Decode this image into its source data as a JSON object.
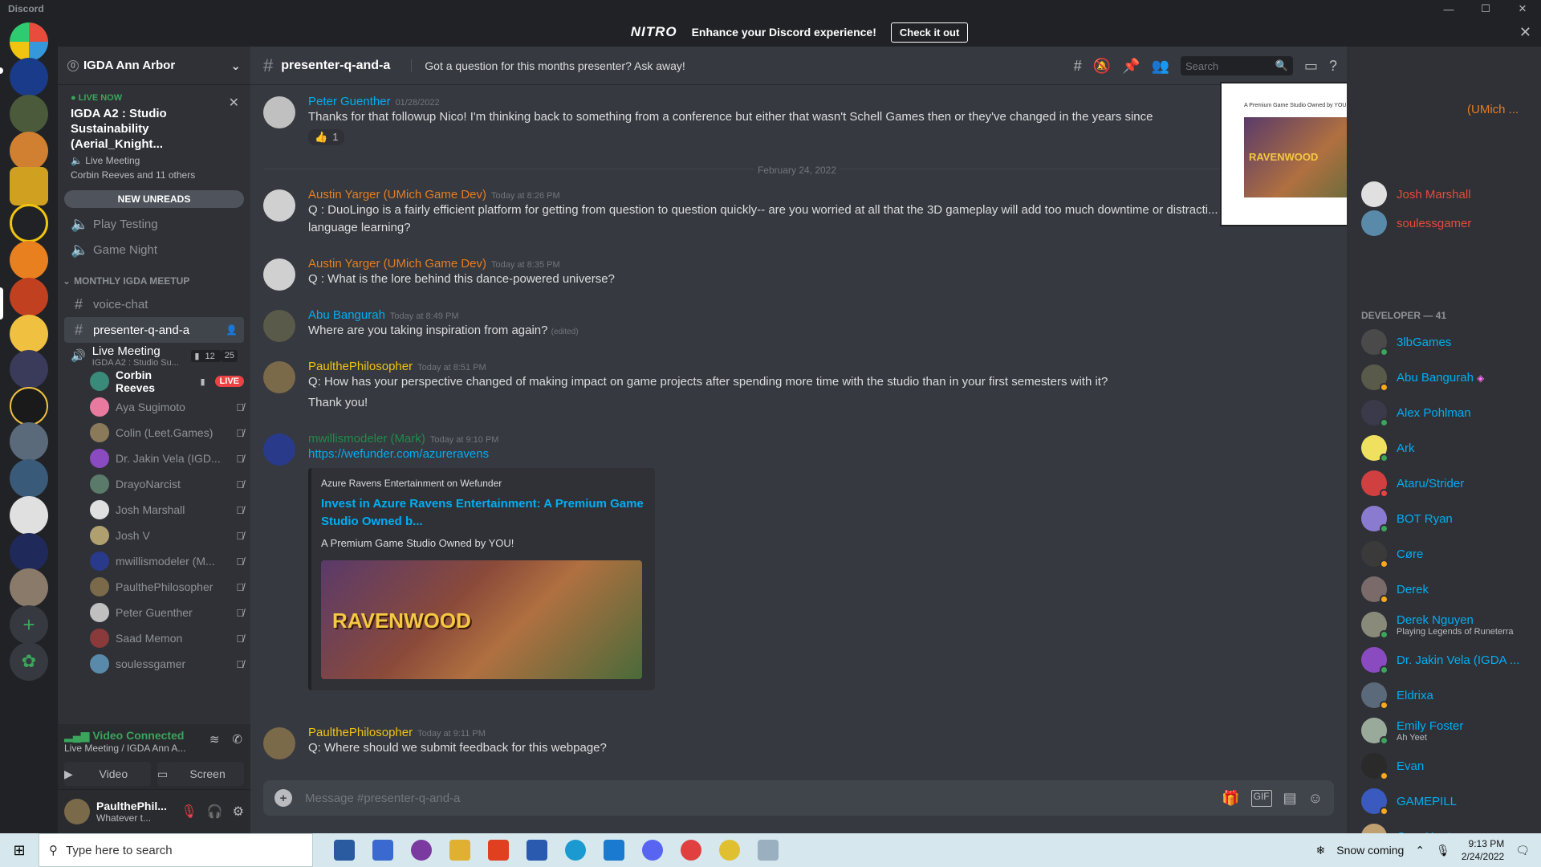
{
  "app": {
    "title": "Discord"
  },
  "window_controls": {
    "minimize": "—",
    "maximize": "☐",
    "close": "✕"
  },
  "nitro": {
    "logo": "NITRO",
    "text": "Enhance your Discord experience!",
    "button": "Check it out",
    "close": "✕"
  },
  "server": {
    "name": "IGDA Ann Arbor",
    "boost": "0"
  },
  "live_now": {
    "label": "LIVE NOW",
    "title": "IGDA A2 : Studio Sustainability (Aerial_Knight...",
    "type": "Live Meeting",
    "participants": "Corbin Reeves and 11 others"
  },
  "new_unreads": "NEW UNREADS",
  "channels_top": [
    {
      "name": "Play Testing",
      "type": "voice"
    },
    {
      "name": "Game Night",
      "type": "voice"
    }
  ],
  "category": "MONTHLY IGDA MEETUP",
  "channels_cat": [
    {
      "name": "voice-chat",
      "type": "text"
    },
    {
      "name": "presenter-q-and-a",
      "type": "text",
      "active": true
    }
  ],
  "voice_channel": {
    "name": "Live Meeting",
    "sub": "IGDA A2 : Studio Su...",
    "video_count": "12",
    "user_count": "25"
  },
  "voice_users": [
    {
      "name": "Corbin Reeves",
      "live": "LIVE",
      "color": "#3a8a7a"
    },
    {
      "name": "Aya Sugimoto",
      "color": "#e87aa0"
    },
    {
      "name": "Colin (Leet.Games)",
      "color": "#8a7a5a"
    },
    {
      "name": "Dr. Jakin Vela (IGD...",
      "color": "#8a4ac0"
    },
    {
      "name": "DrayoNarcist",
      "color": "#5a7a6a"
    },
    {
      "name": "Josh Marshall",
      "color": "#e0e0e0"
    },
    {
      "name": "Josh V",
      "color": "#b0a070"
    },
    {
      "name": "mwillismodeler (M...",
      "color": "#2a3a8a"
    },
    {
      "name": "PaulthePhilosopher",
      "color": "#7a6a4a"
    },
    {
      "name": "Peter Guenther",
      "color": "#c0c0c0"
    },
    {
      "name": "Saad Memon",
      "color": "#8a3a3a"
    },
    {
      "name": "soulessgamer",
      "color": "#5a8aaa"
    }
  ],
  "voice_panel": {
    "status": "Video Connected",
    "location": "Live Meeting / IGDA Ann A...",
    "video": "Video",
    "screen": "Screen"
  },
  "user_panel": {
    "name": "PaulthePhil...",
    "status": "Whatever t..."
  },
  "chat_header": {
    "channel": "presenter-q-and-a",
    "topic": "Got a question for this months presenter? Ask away!",
    "search_placeholder": "Search"
  },
  "date_divider": "February 24, 2022",
  "messages": [
    {
      "author": "Peter Guenther",
      "color": "#00aff4",
      "time": "01/28/2022",
      "text": "Thanks for that followup Nico! I'm thinking back to something from a conference but either that wasn't Schell Games then or they've changed in the years since",
      "reaction_count": "1",
      "avatar": "#c0c0c0"
    },
    {
      "author": "Austin Yarger (UMich Game Dev)",
      "color": "#e67e22",
      "time": "Today at 8:26 PM",
      "text": "Q : DuoLingo is a fairly efficient platform for getting from question to question quickly-- are you worried at all that the 3D gameplay will add too much downtime or distracti...",
      "text2": "language learning?",
      "avatar": "#d0d0d0"
    },
    {
      "author": "Austin Yarger (UMich Game Dev)",
      "color": "#e67e22",
      "time": "Today at 8:35 PM",
      "text": "Q : What is the lore behind this dance-powered universe?",
      "avatar": "#d0d0d0"
    },
    {
      "author": "Abu Bangurah",
      "color": "#00aff4",
      "time": "Today at 8:49 PM",
      "text": "Where are you taking inspiration from again?",
      "edited": "(edited)",
      "avatar": "#5a5a4a"
    },
    {
      "author": "PaulthePhilosopher",
      "color": "#f1c40f",
      "time": "Today at 8:51 PM",
      "text": "Q: How has your perspective changed of making impact on game projects after spending more time with the studio than in your first semesters with it?",
      "text2": "Thank you!",
      "avatar": "#7a6a4a"
    },
    {
      "author": "mwillismodeler (Mark)",
      "color": "#1f8b4c",
      "time": "Today at 9:10 PM",
      "link": "https://wefunder.com/azureravens",
      "avatar": "#2a3a8a"
    },
    {
      "author": "PaulthePhilosopher",
      "color": "#f1c40f",
      "time": "Today at 9:11 PM",
      "text": "Q: Where should we submit feedback for this webpage?",
      "avatar": "#7a6a4a"
    }
  ],
  "embed": {
    "provider": "Azure Ravens Entertainment on Wefunder",
    "title": "Invest in Azure Ravens Entertainment: A Premium Game Studio Owned b...",
    "description": "A Premium Game Studio Owned by YOU!",
    "image_text": "RAVENWOOD"
  },
  "composer": {
    "placeholder": "Message #presenter-q-and-a"
  },
  "pip": {
    "title": "A Premium Game Studio Owned by YOU!",
    "image_text": "RAVENWOOD"
  },
  "members": {
    "top": [
      {
        "name": "(UMich ...",
        "color": "#e67e22"
      },
      {
        "name": "Josh Marshall",
        "color": "#e74c3c",
        "avatar": "#e0e0e0"
      },
      {
        "name": "soulessgamer",
        "color": "#e74c3c",
        "avatar": "#5a8aaa"
      }
    ],
    "group": "DEVELOPER — 41",
    "list": [
      {
        "name": "3lbGames",
        "avatar": "#4a4a4a",
        "status": "online"
      },
      {
        "name": "Abu Bangurah",
        "avatar": "#5a5a4a",
        "status": "idle",
        "badge": "◈"
      },
      {
        "name": "Alex Pohlman",
        "avatar": "#3a3a4a",
        "status": "online"
      },
      {
        "name": "Ark",
        "avatar": "#f0e060",
        "status": "online"
      },
      {
        "name": "Ataru/Strider",
        "avatar": "#d04040",
        "status": "dnd"
      },
      {
        "name": "BOT Ryan",
        "avatar": "#8a7ad0",
        "status": "online"
      },
      {
        "name": "Cøre",
        "avatar": "#3a3a3a",
        "status": "idle"
      },
      {
        "name": "Derek",
        "avatar": "#7a6a6a",
        "status": "idle"
      },
      {
        "name": "Derek Nguyen",
        "avatar": "#8a8a7a",
        "status": "online",
        "sub": "Playing Legends of Runeterra"
      },
      {
        "name": "Dr. Jakin Vela (IGDA ...",
        "avatar": "#8a4ac0",
        "status": "online"
      },
      {
        "name": "Eldrixa",
        "avatar": "#5a6a7a",
        "status": "idle"
      },
      {
        "name": "Emily Foster",
        "avatar": "#9aaa9a",
        "status": "online",
        "sub": "Ah Yeet"
      },
      {
        "name": "Evan",
        "avatar": "#2a2a2a",
        "status": "idle"
      },
      {
        "name": "GAMEPILL",
        "avatar": "#3a5ac0",
        "status": "idle"
      },
      {
        "name": "Cory Hunter",
        "avatar": "#c0a070",
        "status": "online"
      }
    ]
  },
  "taskbar": {
    "search": "Type here to search",
    "weather": "Snow coming",
    "time": "9:13 PM",
    "date": "2/24/2022"
  },
  "colors": {
    "accent": "#5865f2",
    "online": "#3ba55c",
    "idle": "#faa81a",
    "dnd": "#ed4245",
    "link": "#00aff4"
  }
}
